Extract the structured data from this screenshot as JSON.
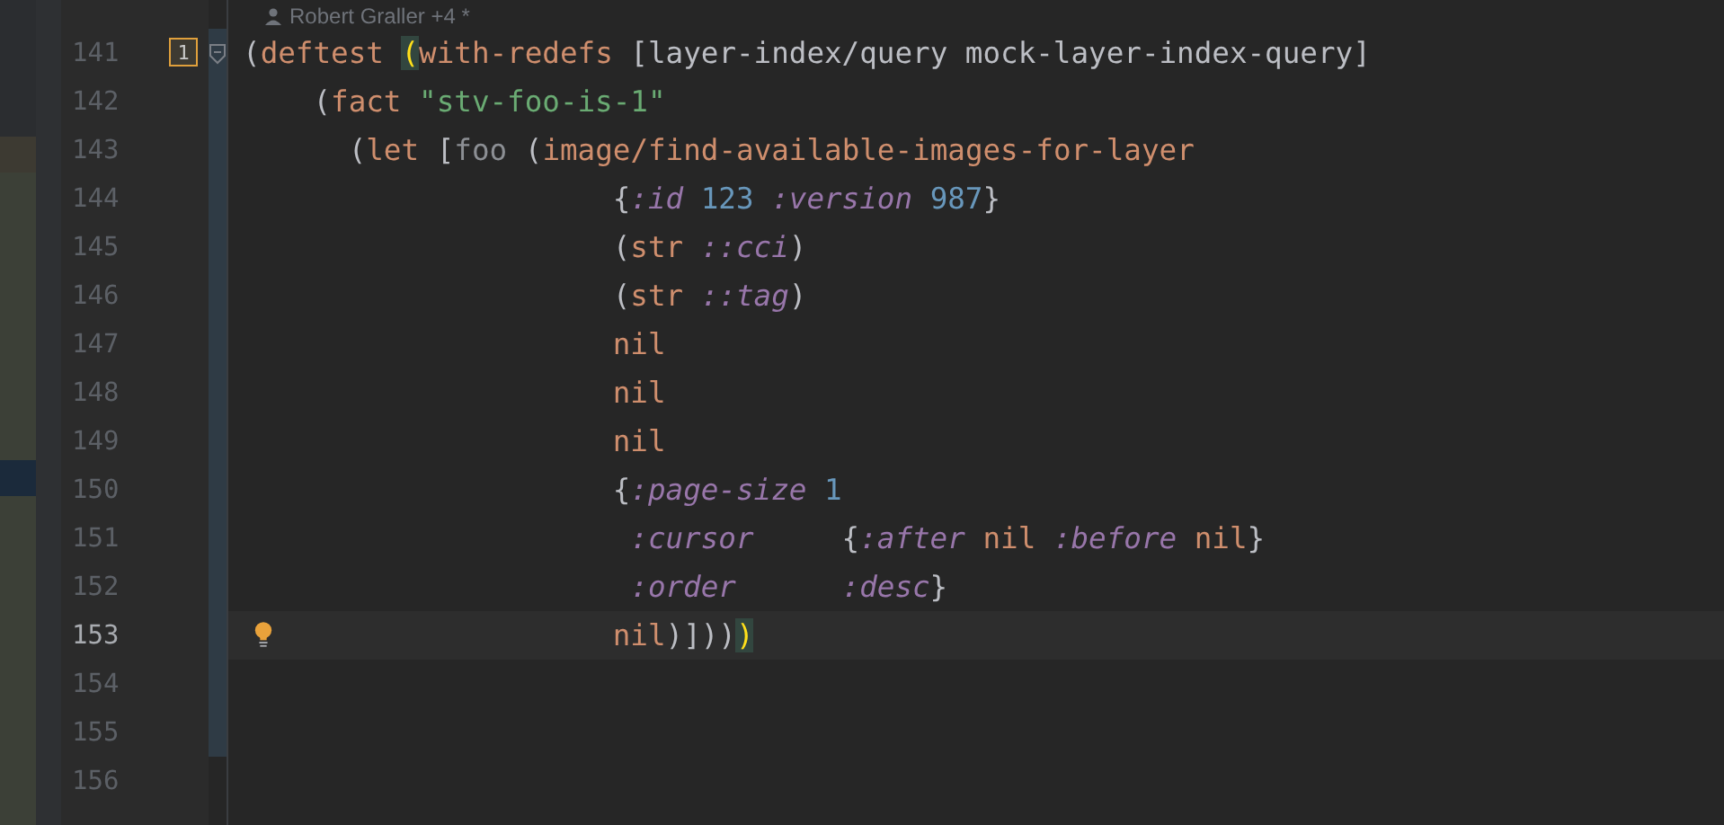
{
  "header": {
    "author": "Robert Graller +4 *"
  },
  "lines": [
    {
      "number": "141",
      "current": false,
      "modified": true,
      "bookmark": "1",
      "foldable": true,
      "tokens": [
        {
          "text": "(",
          "kind": "punct"
        },
        {
          "text": "deftest ",
          "kind": "kw"
        },
        {
          "text": "(",
          "kind": "match"
        },
        {
          "text": "with-redefs",
          "kind": "kw"
        },
        {
          "text": " [layer-index/query mock-layer-index-query]",
          "kind": "plain"
        }
      ]
    },
    {
      "number": "142",
      "current": false,
      "modified": true,
      "tokens": [
        {
          "text": "    (",
          "kind": "punct"
        },
        {
          "text": "fact ",
          "kind": "kw"
        },
        {
          "text": "\"stv-foo-is-1\"",
          "kind": "str"
        }
      ]
    },
    {
      "number": "143",
      "current": false,
      "modified": true,
      "tokens": [
        {
          "text": "      (",
          "kind": "punct"
        },
        {
          "text": "let",
          "kind": "kw"
        },
        {
          "text": " [",
          "kind": "punct"
        },
        {
          "text": "foo",
          "kind": "local"
        },
        {
          "text": " (",
          "kind": "punct"
        },
        {
          "text": "image/find-available-images-for-layer",
          "kind": "kw"
        }
      ]
    },
    {
      "number": "144",
      "current": false,
      "modified": true,
      "tokens": [
        {
          "text": "                     {",
          "kind": "punct"
        },
        {
          "text": ":id ",
          "kind": "kwd"
        },
        {
          "text": "123 ",
          "kind": "num"
        },
        {
          "text": ":version ",
          "kind": "kwd"
        },
        {
          "text": "987",
          "kind": "num"
        },
        {
          "text": "}",
          "kind": "punct"
        }
      ]
    },
    {
      "number": "145",
      "current": false,
      "modified": true,
      "tokens": [
        {
          "text": "                     (",
          "kind": "punct"
        },
        {
          "text": "str ",
          "kind": "kw"
        },
        {
          "text": "::cci",
          "kind": "kwd"
        },
        {
          "text": ")",
          "kind": "punct"
        }
      ]
    },
    {
      "number": "146",
      "current": false,
      "modified": true,
      "tokens": [
        {
          "text": "                     (",
          "kind": "punct"
        },
        {
          "text": "str ",
          "kind": "kw"
        },
        {
          "text": "::tag",
          "kind": "kwd"
        },
        {
          "text": ")",
          "kind": "punct"
        }
      ]
    },
    {
      "number": "147",
      "current": false,
      "modified": true,
      "tokens": [
        {
          "text": "                     nil",
          "kind": "kw"
        }
      ]
    },
    {
      "number": "148",
      "current": false,
      "modified": true,
      "tokens": [
        {
          "text": "                     nil",
          "kind": "kw"
        }
      ]
    },
    {
      "number": "149",
      "current": false,
      "modified": true,
      "tokens": [
        {
          "text": "                     nil",
          "kind": "kw"
        }
      ]
    },
    {
      "number": "150",
      "current": false,
      "modified": true,
      "tokens": [
        {
          "text": "                     {",
          "kind": "punct"
        },
        {
          "text": ":page-size ",
          "kind": "kwd"
        },
        {
          "text": "1",
          "kind": "num"
        }
      ]
    },
    {
      "number": "151",
      "current": false,
      "modified": true,
      "tokens": [
        {
          "text": "                      :cursor",
          "kind": "kwd"
        },
        {
          "text": "     {",
          "kind": "punct"
        },
        {
          "text": ":after ",
          "kind": "kwd"
        },
        {
          "text": "nil ",
          "kind": "kw"
        },
        {
          "text": ":before ",
          "kind": "kwd"
        },
        {
          "text": "nil",
          "kind": "kw"
        },
        {
          "text": "}",
          "kind": "punct"
        }
      ]
    },
    {
      "number": "152",
      "current": false,
      "modified": true,
      "tokens": [
        {
          "text": "                      :order",
          "kind": "kwd"
        },
        {
          "text": "      :desc",
          "kind": "kwd"
        },
        {
          "text": "}",
          "kind": "punct"
        }
      ]
    },
    {
      "number": "153",
      "current": true,
      "modified": true,
      "intention": true,
      "tokens": [
        {
          "text": "                     nil",
          "kind": "kw"
        },
        {
          "text": ")]))",
          "kind": "punct"
        },
        {
          "text": ")",
          "kind": "match"
        }
      ]
    },
    {
      "number": "154",
      "current": false,
      "modified": true
    },
    {
      "number": "155",
      "current": false,
      "modified": true
    },
    {
      "number": "156",
      "current": false,
      "modified": false
    }
  ]
}
